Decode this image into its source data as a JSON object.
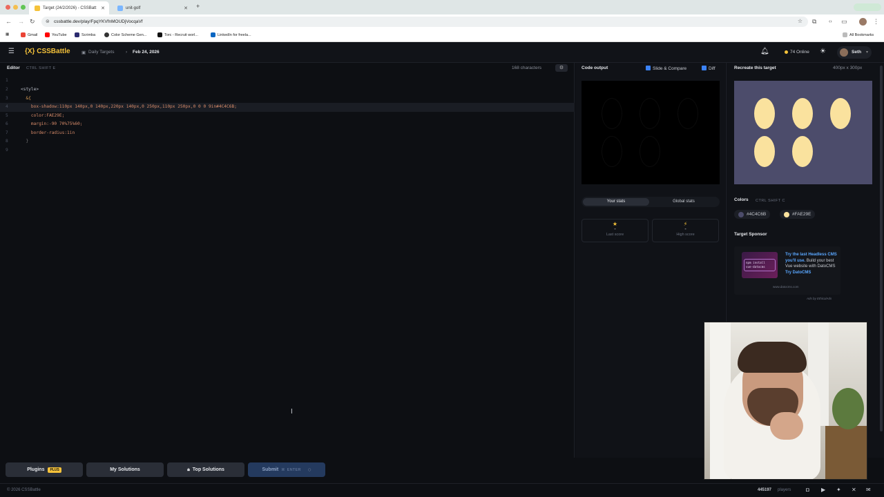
{
  "browser": {
    "tabs": [
      {
        "label": "Target (24/2/2026) - CSSBatt"
      },
      {
        "label": "unit-golf"
      }
    ],
    "new_tab": "+",
    "url": "cssbattle.dev/play/FpqYKVfnMOUDjVocqaVf",
    "bookmarks": [
      "Gmail",
      "YouTube",
      "Scrimba",
      "Color Scheme Gen...",
      "Torc - Recruit worl...",
      "LinkedIn for freela..."
    ],
    "all_bookmarks": "All Bookmarks"
  },
  "header": {
    "logo": "{X} CSSBattle",
    "crumb_daily": "Daily Targets",
    "crumb_date": "Feb 24, 2026",
    "online_count": "74 Online",
    "user": "Seth"
  },
  "editor": {
    "title": "Editor",
    "shortcut": "CTRL SHIFT E",
    "char_count": "168 characters",
    "lines": [
      {
        "n": "1",
        "text": ""
      },
      {
        "n": "2",
        "text": "<style>"
      },
      {
        "n": "3",
        "text": "  &{"
      },
      {
        "n": "4",
        "text": "    box-shadow:110px 140px,0 140px,220px 140px,0 250px,110px 250px,0 0 0 9in#4C4C6B;"
      },
      {
        "n": "5",
        "text": "    color:FAE29E;"
      },
      {
        "n": "6",
        "text": "    margin:-90 70%75%60;"
      },
      {
        "n": "7",
        "text": "    border-radius:1in"
      },
      {
        "n": "8",
        "text": "  }"
      },
      {
        "n": "9",
        "text": ""
      }
    ]
  },
  "output": {
    "title": "Code output",
    "slide_compare": "Slide & Compare",
    "diff": "Diff",
    "stats_tabs": [
      "Your stats",
      "Global stats"
    ],
    "last_score_value": "-",
    "last_score_label": "Last score",
    "high_score_value": "-",
    "high_score_label": "High score"
  },
  "target": {
    "title": "Recreate this target",
    "size": "400px x 300px",
    "bg_color": "#4C4C6B",
    "shape_color": "#FAE29E",
    "colors_title": "Colors",
    "colors_shortcut": "CTRL SHIFT C",
    "colors": [
      "#4C4C6B",
      "#FAE29E"
    ],
    "sponsor_title": "Target Sponsor",
    "sponsor_code": "npm install vue-datocms",
    "sponsor_text_1": "Try the last Headless CMS you'll use.",
    "sponsor_text_2": "Build your best Vue website with DatoCMS",
    "sponsor_text_3": "Try DatoCMS",
    "sponsor_url": "www.datocms.com",
    "ads_by": "Ads by EthicalAds"
  },
  "actions": {
    "plugins": "Plugins",
    "plus_badge": "PLUS",
    "my_solutions": "My Solutions",
    "top_solutions": "Top Solutions",
    "submit": "Submit",
    "submit_shortcut": "ENTER"
  },
  "footer": {
    "copyright": "© 2026 CSSBattle",
    "players": "445197",
    "players_label": "players"
  }
}
